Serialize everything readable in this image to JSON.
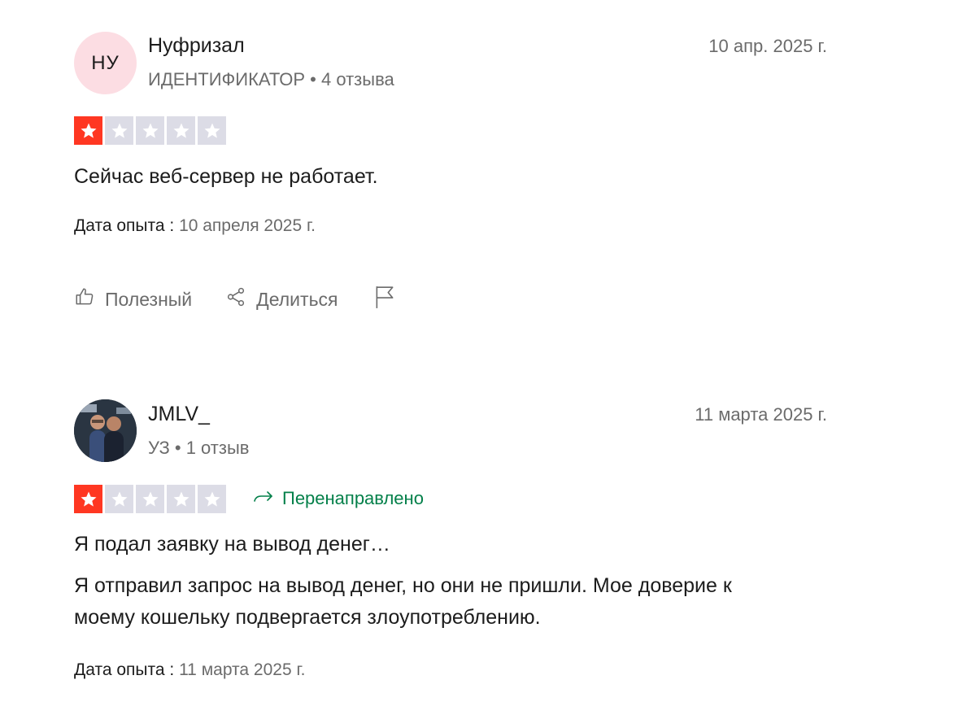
{
  "reviews": [
    {
      "avatar_initials": "НУ",
      "avatar_color": "#fcdde3",
      "name": "Нуфризал",
      "meta": "ИДЕНТИФИКАТОР • 4 отзыва",
      "date": "10 апр. 2025 г.",
      "rating": 1,
      "body": "Сейчас веб-сервер не работает.",
      "experience_label": "Дата опыта :",
      "experience_date": "10 апреля 2025 г.",
      "actions": {
        "helpful": "Полезный",
        "share": "Делиться"
      }
    },
    {
      "avatar": "photo",
      "name": "JMLV_",
      "meta": "УЗ • 1 отзыв",
      "date": "11 марта 2025 г.",
      "rating": 1,
      "redirect_label": "Перенаправлено",
      "title": "Я подал заявку на вывод денег…",
      "body": "Я отправил запрос на вывод денег, но они не пришли. Мое доверие к моему кошельку подвергается злоупотреблению.",
      "experience_label": "Дата опыта :",
      "experience_date": "11 марта 2025 г."
    }
  ],
  "colors": {
    "star_filled": "#ff3722",
    "star_empty": "#dcdce6",
    "redirect_green": "#04804a",
    "muted_text": "#6b6b6b"
  }
}
